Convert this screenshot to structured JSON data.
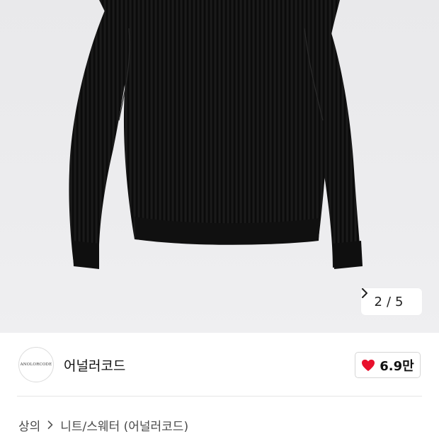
{
  "gallery": {
    "current": "2",
    "separator": "/",
    "total": "5",
    "next_icon": "chevron-right-icon",
    "image_subject": "black ribbed knit sweater"
  },
  "brand": {
    "logo_text": "ANOLORCODE",
    "name": "어널러코드"
  },
  "like": {
    "icon": "heart-icon",
    "count": "6.9만",
    "color": "#e8112d"
  },
  "breadcrumb": {
    "items": [
      "상의",
      "니트/스웨터 (어널러코드)"
    ],
    "separator_icon": "chevron-right-icon"
  }
}
